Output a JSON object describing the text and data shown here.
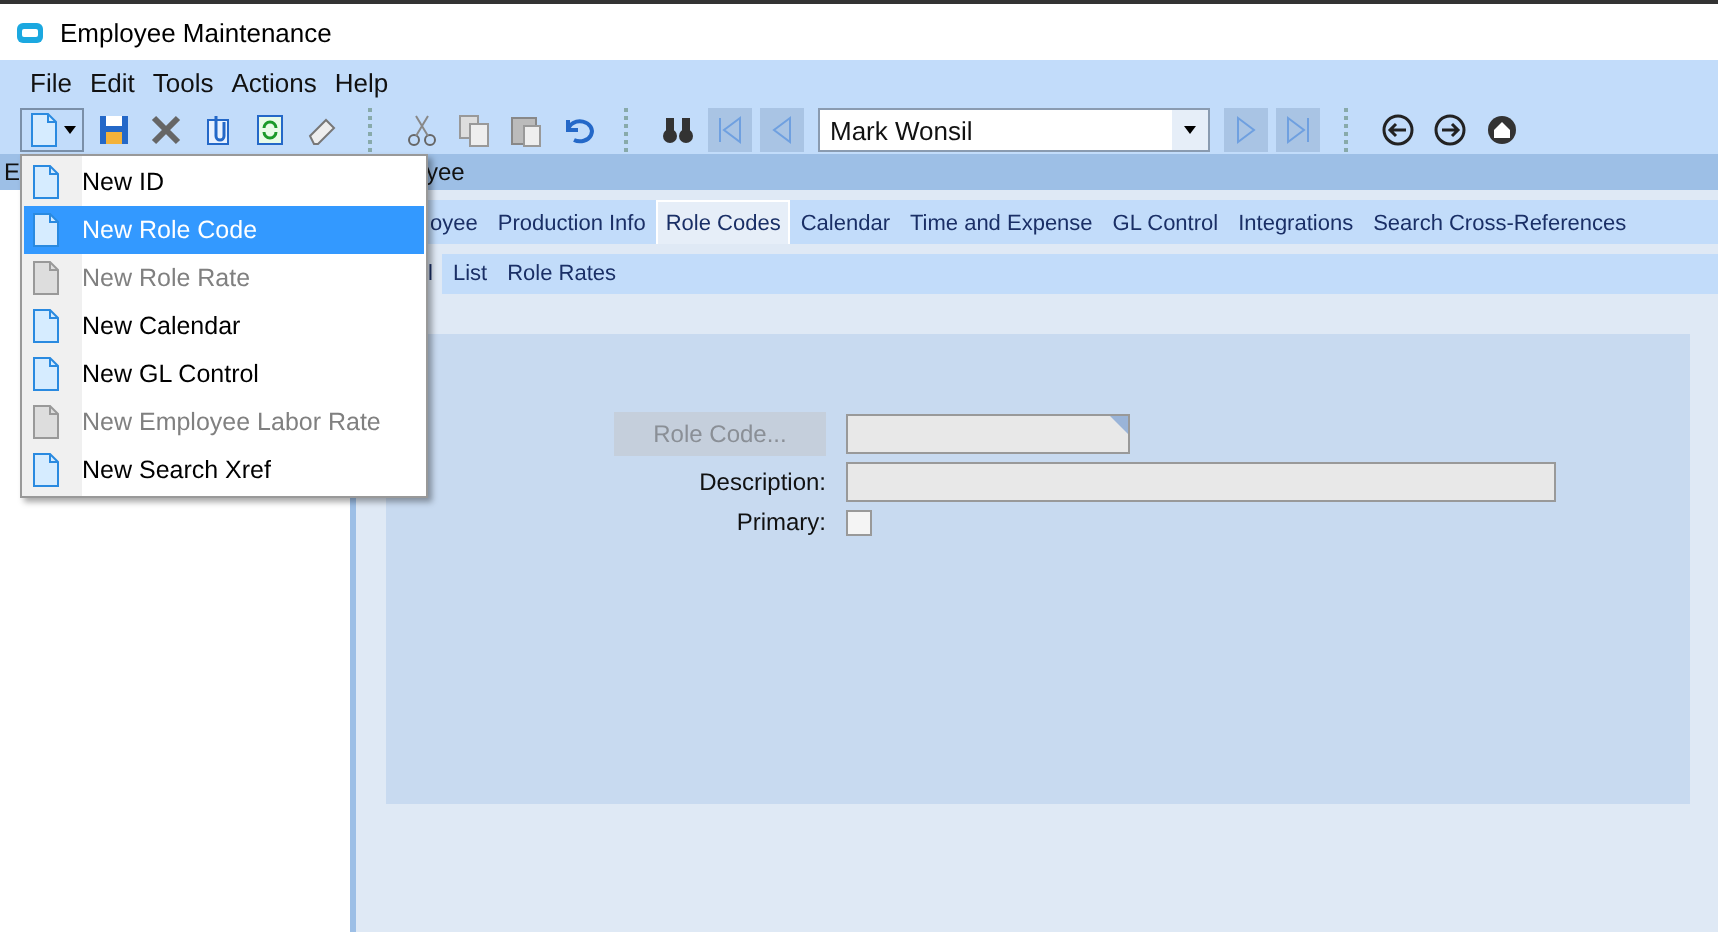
{
  "window": {
    "title": "Employee Maintenance"
  },
  "menu_bar": [
    "File",
    "Edit",
    "Tools",
    "Actions",
    "Help"
  ],
  "toolbar": {
    "record_combo": {
      "value": "Mark Wonsil"
    }
  },
  "new_menu": {
    "items": [
      {
        "label": "New ID",
        "disabled": false,
        "selected": false
      },
      {
        "label": "New Role Code",
        "disabled": false,
        "selected": true
      },
      {
        "label": "New Role Rate",
        "disabled": true,
        "selected": false
      },
      {
        "label": "New Calendar",
        "disabled": false,
        "selected": false
      },
      {
        "label": "New GL Control",
        "disabled": false,
        "selected": false
      },
      {
        "label": "New Employee Labor Rate",
        "disabled": true,
        "selected": false
      },
      {
        "label": "New Search Xref",
        "disabled": false,
        "selected": false
      }
    ]
  },
  "tree_panel": {
    "header": "E"
  },
  "detail_panel": {
    "header": "yee",
    "tabs": [
      {
        "label": "oyee",
        "selected": false
      },
      {
        "label": "Production Info",
        "selected": false
      },
      {
        "label": "Role Codes",
        "selected": true
      },
      {
        "label": "Calendar",
        "selected": false
      },
      {
        "label": "Time and Expense",
        "selected": false
      },
      {
        "label": "GL Control",
        "selected": false
      },
      {
        "label": "Integrations",
        "selected": false
      },
      {
        "label": "Search Cross-References",
        "selected": false
      }
    ],
    "subtabs": [
      {
        "label": "l",
        "selected": true
      },
      {
        "label": "List",
        "selected": false
      },
      {
        "label": "Role Rates",
        "selected": false
      }
    ],
    "form": {
      "fields": [
        {
          "kind": "lookup",
          "label": "Role Code...",
          "disabled": true
        },
        {
          "kind": "text",
          "label": "Description:"
        },
        {
          "kind": "checkbox",
          "label": "Primary:",
          "checked": false
        }
      ]
    }
  }
}
